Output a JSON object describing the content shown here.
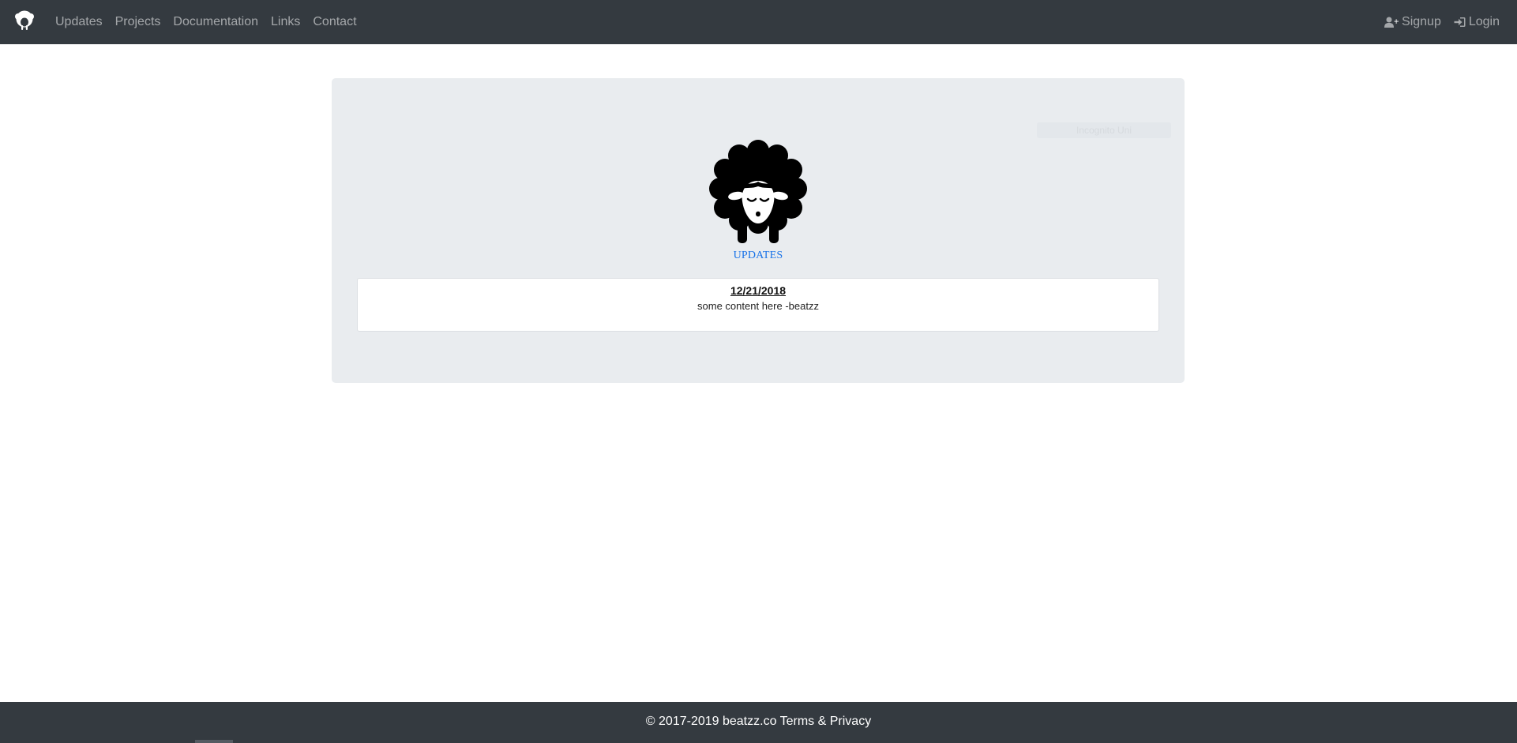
{
  "nav": {
    "brand_icon": "sheep-icon",
    "links": [
      "Updates",
      "Projects",
      "Documentation",
      "Links",
      "Contact"
    ],
    "signup_label": "Signup",
    "signup_icon": "user-plus-icon",
    "login_label": "Login",
    "login_icon": "sign-in-icon"
  },
  "main": {
    "logo_icon": "sheep-icon",
    "section_title": "UPDATES",
    "post": {
      "date": "12/21/2018",
      "content": "some content here -beatzz"
    },
    "ghost_badge": "Incognito Uni"
  },
  "footer": {
    "copyright": "© 2017-2019 beatzz.co",
    "terms_label": "Terms & Privacy"
  },
  "colors": {
    "navbar_bg": "#343a40",
    "panel_bg": "#e9ecef",
    "accent": "#1a73e8"
  }
}
